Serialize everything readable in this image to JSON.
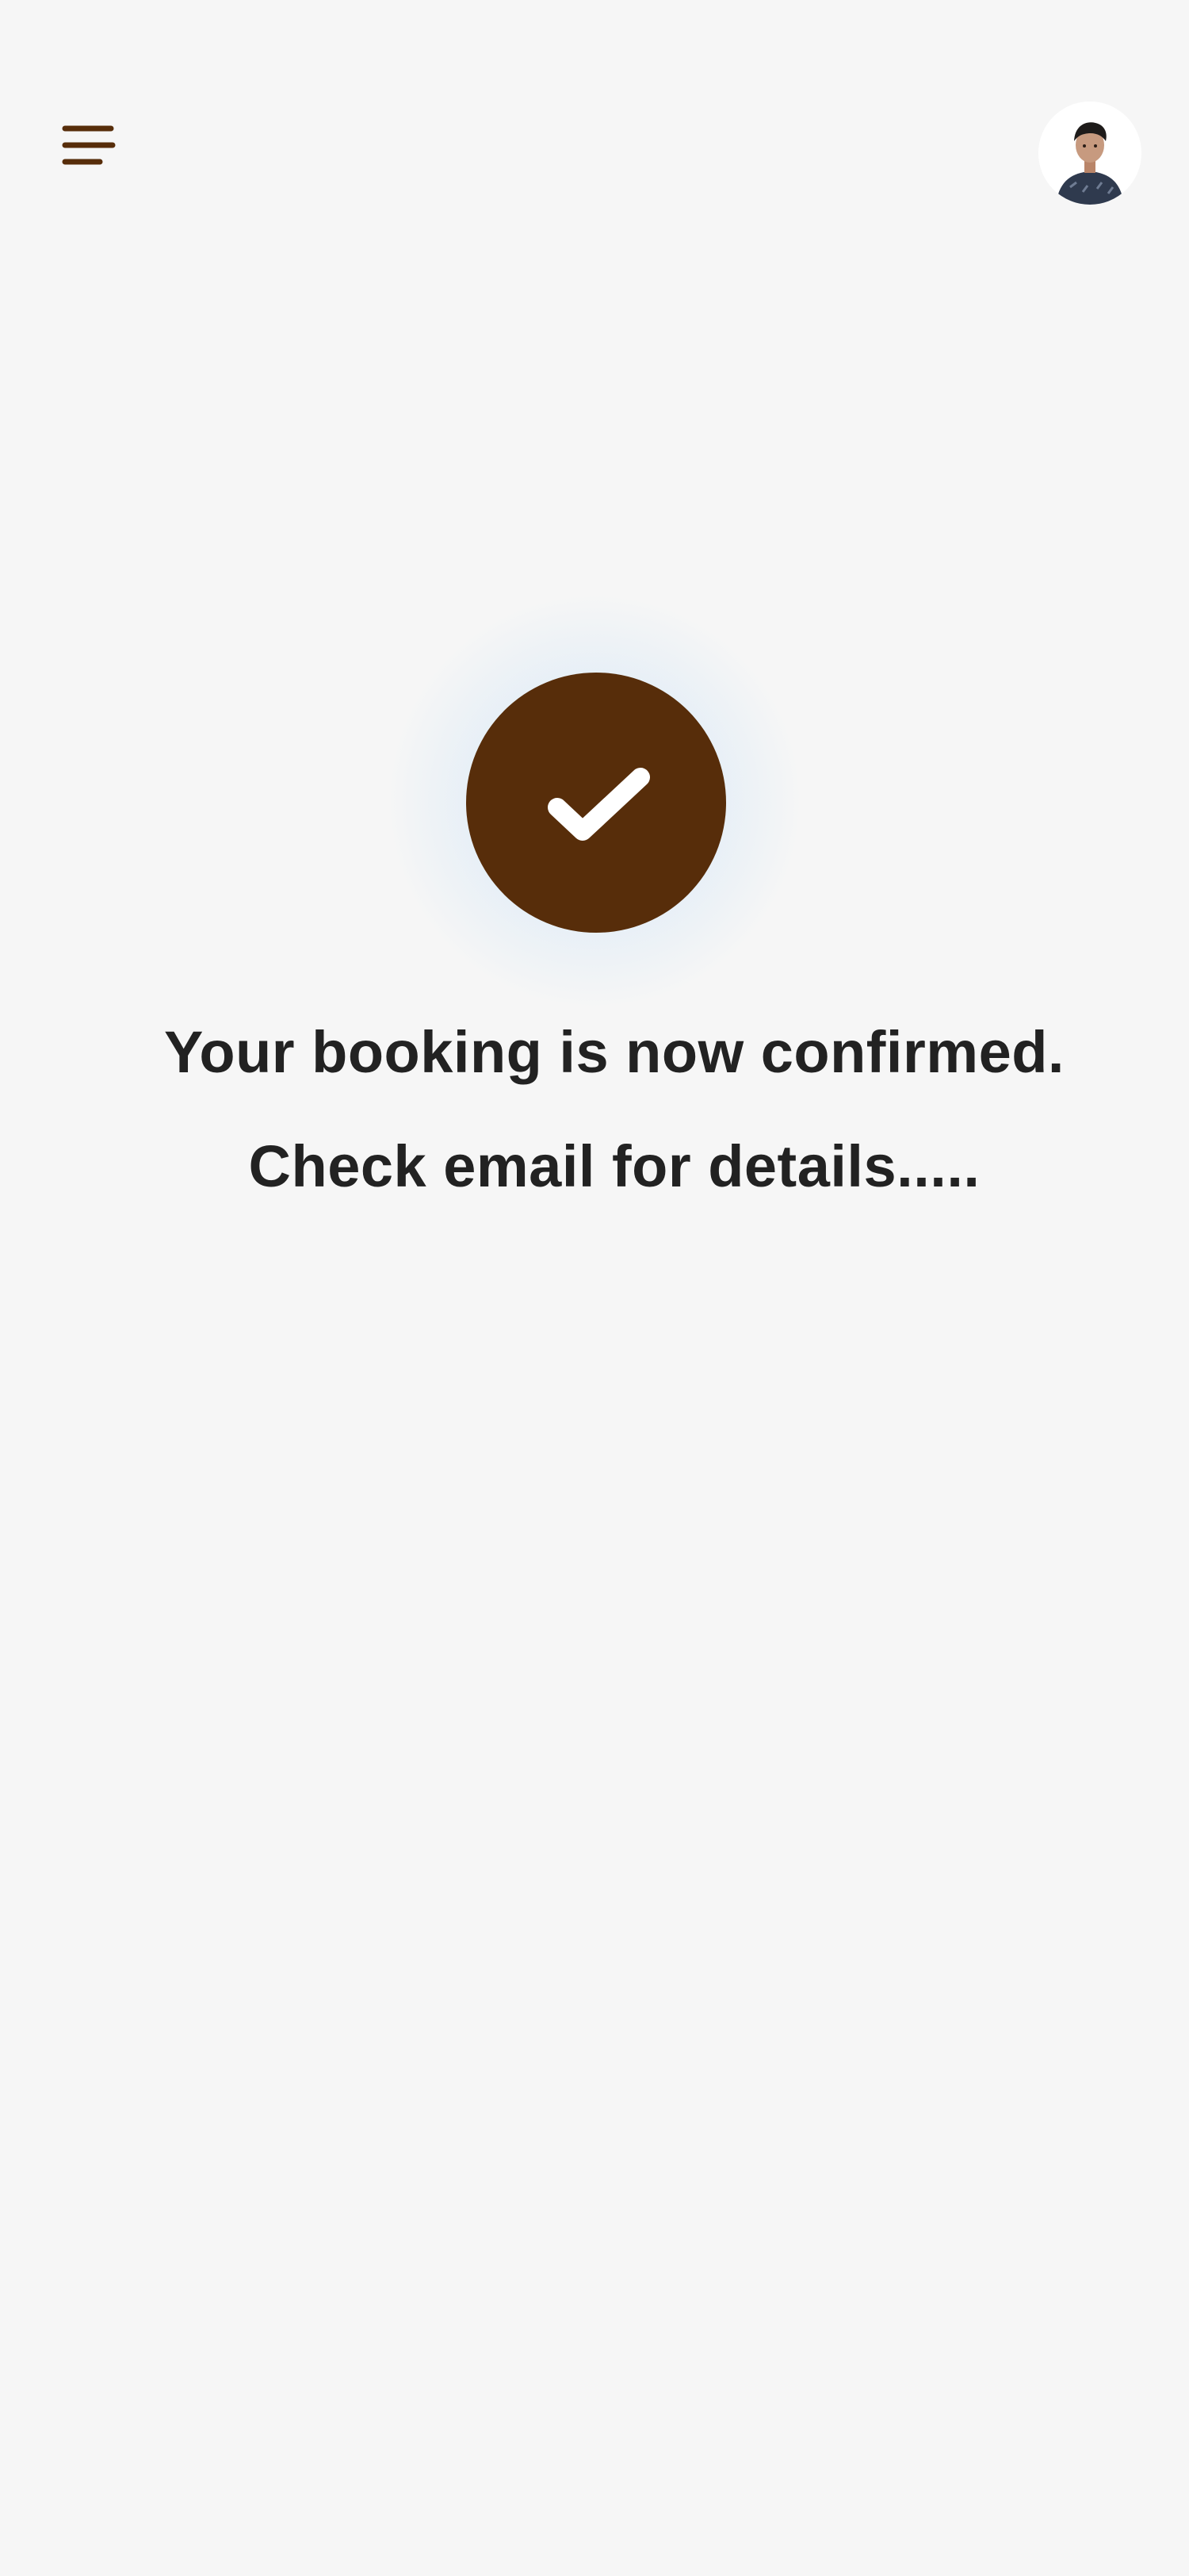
{
  "header": {
    "menu_icon": "hamburger-menu-icon",
    "avatar_icon": "user-avatar"
  },
  "success": {
    "icon": "checkmark-icon",
    "message": "Your booking is now confirmed. Check email for details.....",
    "accent_color": "#572d0a"
  }
}
